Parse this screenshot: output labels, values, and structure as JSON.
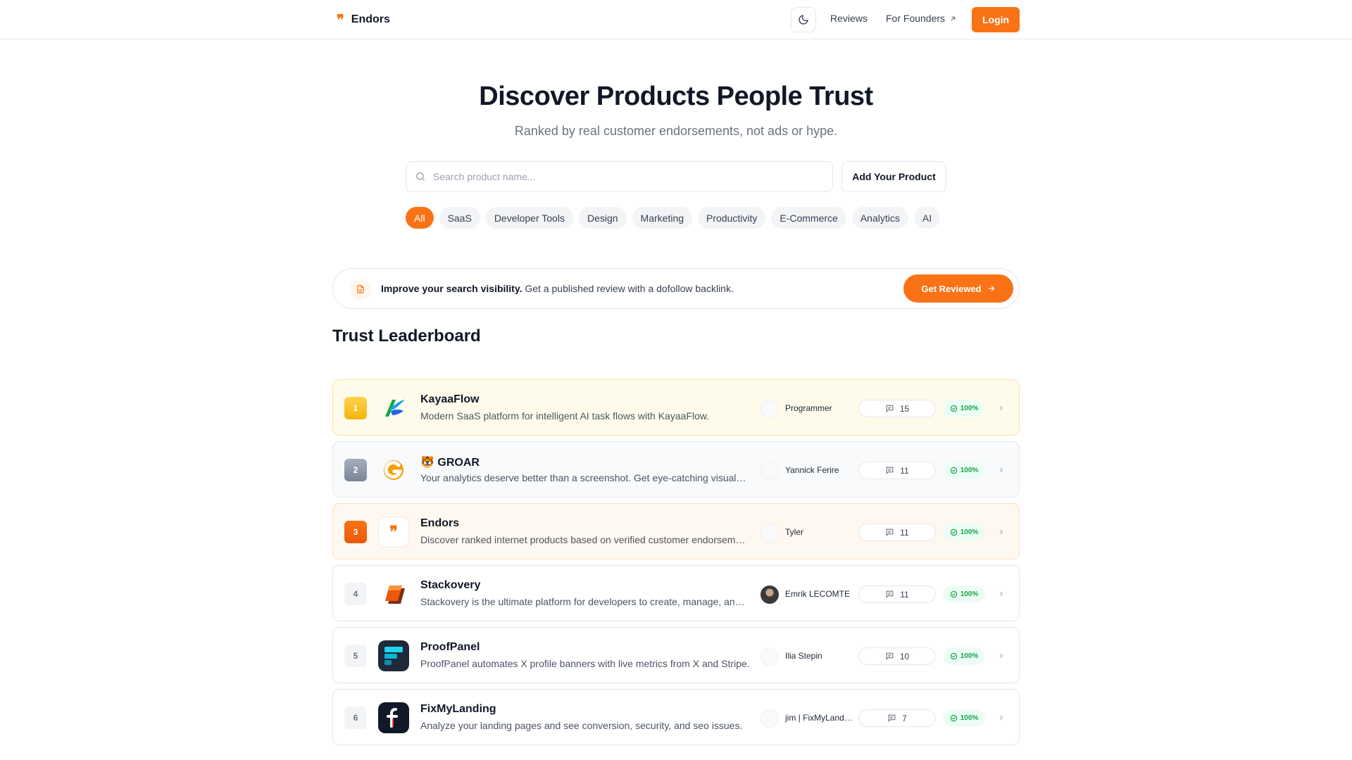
{
  "header": {
    "brand_mark": "❞",
    "brand_name": "Endors",
    "nav": {
      "reviews": "Reviews",
      "founders": "For Founders"
    },
    "login": "Login"
  },
  "hero": {
    "title": "Discover Products People Trust",
    "subtitle": "Ranked by real customer endorsements, not ads or hype."
  },
  "search": {
    "placeholder": "Search product name...",
    "value": ""
  },
  "add_product": "Add Your Product",
  "categories": [
    "All",
    "SaaS",
    "Developer Tools",
    "Design",
    "Marketing",
    "Productivity",
    "E-Commerce",
    "Analytics",
    "AI"
  ],
  "selected_category": "All",
  "banner": {
    "bold": "Improve your search visibility.",
    "text": " Get a published review with a dofollow backlink.",
    "cta": "Get Reviewed"
  },
  "leaderboard": {
    "title": "Trust Leaderboard",
    "rows": [
      {
        "rank": "1",
        "name": "KayaaFlow",
        "description": "Modern SaaS platform for intelligent AI task flows with KayaaFlow.",
        "founder": "Programmer",
        "reviews": "15",
        "trust": "100%"
      },
      {
        "rank": "2",
        "name": "🐯 GROAR",
        "description": "Your analytics deserve better than a screenshot. Get eye-catching visuals for your stats.",
        "founder": "Yannick Ferire",
        "reviews": "11",
        "trust": "100%"
      },
      {
        "rank": "3",
        "name": "Endors",
        "description": "Discover ranked internet products based on verified customer endorsements.",
        "founder": "Tyler",
        "reviews": "11",
        "trust": "100%"
      },
      {
        "rank": "4",
        "name": "Stackovery",
        "description": "Stackovery is the ultimate platform for developers to create, manage, and share stacks.",
        "founder": "Emrik LECOMTE",
        "reviews": "11",
        "trust": "100%"
      },
      {
        "rank": "5",
        "name": "ProofPanel",
        "description": "ProofPanel automates X profile banners with live metrics from X and Stripe.",
        "founder": "Ilia Stepin",
        "reviews": "10",
        "trust": "100%"
      },
      {
        "rank": "6",
        "name": "FixMyLanding",
        "description": "Analyze your landing pages and see conversion, security, and seo issues.",
        "founder": "jim | FixMyLanding",
        "reviews": "7",
        "trust": "100%"
      }
    ]
  },
  "colors": {
    "accent": "#f97316",
    "success": "#16a34a"
  }
}
